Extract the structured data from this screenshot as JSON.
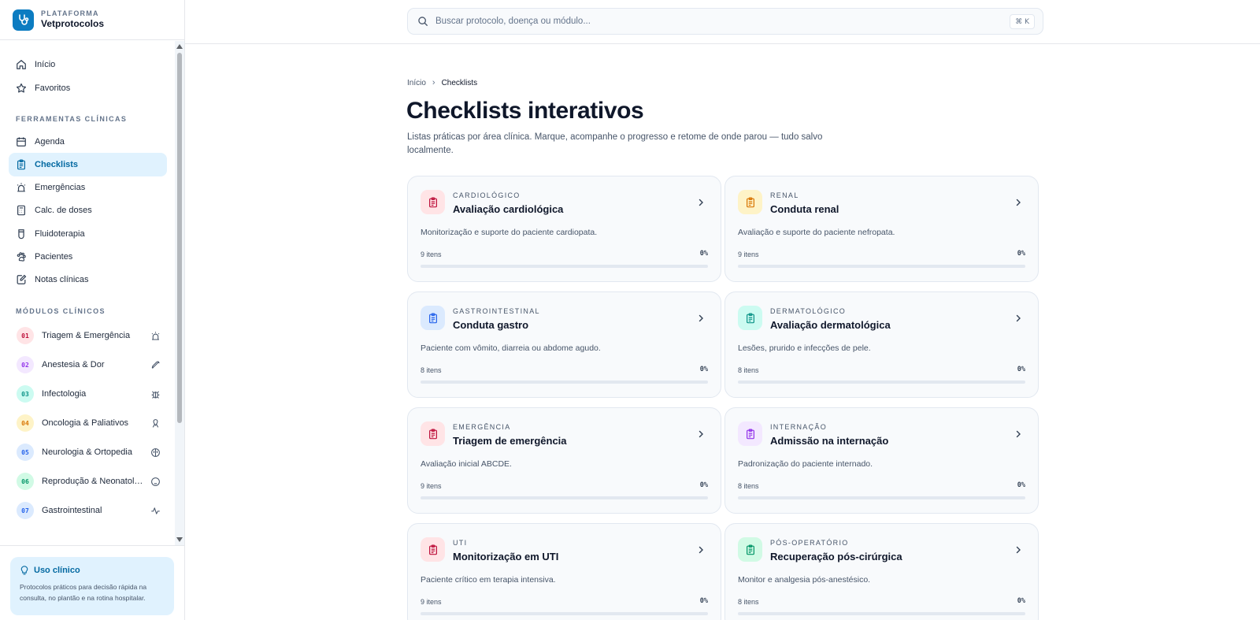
{
  "brand": {
    "kicker": "PLATAFORMA",
    "name": "Vetprotocolos",
    "logo_icon": "stethoscope-icon",
    "accent": "#0c7cc1"
  },
  "search": {
    "placeholder": "Buscar protocolo, doença ou módulo...",
    "shortcut": "⌘ K"
  },
  "sidebar": {
    "main_items": [
      {
        "label": "Início",
        "icon": "home-icon"
      },
      {
        "label": "Favoritos",
        "icon": "star-icon"
      }
    ],
    "tools_title": "FERRAMENTAS CLÍNICAS",
    "tools": [
      {
        "label": "Agenda",
        "icon": "calendar-icon"
      },
      {
        "label": "Checklists",
        "icon": "clipboard-icon",
        "active": true
      },
      {
        "label": "Emergências",
        "icon": "siren-icon"
      },
      {
        "label": "Calc. de doses",
        "icon": "calculator-icon"
      },
      {
        "label": "Fluidoterapia",
        "icon": "iv-bag-icon"
      },
      {
        "label": "Pacientes",
        "icon": "paw-icon"
      },
      {
        "label": "Notas clínicas",
        "icon": "note-icon"
      }
    ],
    "modules_title": "MÓDULOS CLÍNICOS",
    "modules": [
      {
        "num": "01",
        "label": "Triagem & Emergência",
        "color": "#be123c",
        "bg": "#ffe4e6",
        "icon": "siren-icon"
      },
      {
        "num": "02",
        "label": "Anestesia & Dor",
        "color": "#9333ea",
        "bg": "#f3e8ff",
        "icon": "syringe-icon"
      },
      {
        "num": "03",
        "label": "Infectologia",
        "color": "#0d9488",
        "bg": "#ccfbf1",
        "icon": "bug-icon"
      },
      {
        "num": "04",
        "label": "Oncologia & Paliativos",
        "color": "#d97706",
        "bg": "#fef3c7",
        "icon": "ribbon-icon"
      },
      {
        "num": "05",
        "label": "Neurologia & Ortopedia",
        "color": "#2563eb",
        "bg": "#dbeafe",
        "icon": "brain-icon"
      },
      {
        "num": "06",
        "label": "Reprodução & Neonatologia",
        "color": "#059669",
        "bg": "#d1fae5",
        "icon": "baby-icon"
      },
      {
        "num": "07",
        "label": "Gastrointestinal",
        "color": "#2563eb",
        "bg": "#dbeafe",
        "icon": "activity-icon"
      }
    ],
    "footer": {
      "title": "Uso clínico",
      "text": "Protocolos práticos para decisão rápida na consulta, no plantão e na rotina hospitalar."
    }
  },
  "breadcrumb": {
    "home": "Início",
    "current": "Checklists"
  },
  "page": {
    "title": "Checklists interativos",
    "subtitle": "Listas práticas por área clínica. Marque, acompanhe o progresso e retome de onde parou — tudo salvo localmente."
  },
  "cards": [
    {
      "category": "CARDIOLÓGICO",
      "title": "Avaliação cardiológica",
      "description": "Monitorização e suporte do paciente cardiopata.",
      "count": "9 itens",
      "percent": "0%",
      "progress": 0,
      "color": "#be123c",
      "bg": "#ffe4e6"
    },
    {
      "category": "RENAL",
      "title": "Conduta renal",
      "description": "Avaliação e suporte do paciente nefropata.",
      "count": "9 itens",
      "percent": "0%",
      "progress": 0,
      "color": "#d97706",
      "bg": "#fef3c7"
    },
    {
      "category": "GASTROINTESTINAL",
      "title": "Conduta gastro",
      "description": "Paciente com vômito, diarreia ou abdome agudo.",
      "count": "8 itens",
      "percent": "0%",
      "progress": 0,
      "color": "#2563eb",
      "bg": "#dbeafe"
    },
    {
      "category": "DERMATOLÓGICO",
      "title": "Avaliação dermatológica",
      "description": "Lesões, prurido e infecções de pele.",
      "count": "8 itens",
      "percent": "0%",
      "progress": 0,
      "color": "#0d9488",
      "bg": "#ccfbf1"
    },
    {
      "category": "EMERGÊNCIA",
      "title": "Triagem de emergência",
      "description": "Avaliação inicial ABCDE.",
      "count": "9 itens",
      "percent": "0%",
      "progress": 0,
      "color": "#be123c",
      "bg": "#ffe4e6"
    },
    {
      "category": "INTERNAÇÃO",
      "title": "Admissão na internação",
      "description": "Padronização do paciente internado.",
      "count": "8 itens",
      "percent": "0%",
      "progress": 0,
      "color": "#9333ea",
      "bg": "#f3e8ff"
    },
    {
      "category": "UTI",
      "title": "Monitorização em UTI",
      "description": "Paciente crítico em terapia intensiva.",
      "count": "9 itens",
      "percent": "0%",
      "progress": 0,
      "color": "#be123c",
      "bg": "#ffe4e6"
    },
    {
      "category": "PÓS-OPERATÓRIO",
      "title": "Recuperação pós-cirúrgica",
      "description": "Monitor e analgesia pós-anestésico.",
      "count": "8 itens",
      "percent": "0%",
      "progress": 0,
      "color": "#059669",
      "bg": "#d1fae5"
    }
  ]
}
